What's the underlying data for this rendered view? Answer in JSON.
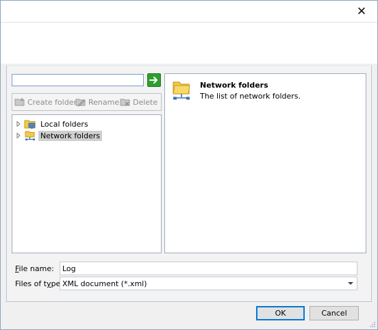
{
  "window": {
    "close_glyph": "✕"
  },
  "search": {
    "value": "",
    "placeholder": ""
  },
  "toolbar": {
    "create_folder_label": "Create folder",
    "rename_label": "Rename",
    "delete_label": "Delete"
  },
  "tree": {
    "items": [
      {
        "label": "Local folders",
        "icon": "local-folders-icon",
        "selected": false
      },
      {
        "label": "Network folders",
        "icon": "network-folders-icon",
        "selected": true
      }
    ]
  },
  "info": {
    "title": "Network folders",
    "description": "The list of network folders.",
    "icon": "network-folders-icon"
  },
  "form": {
    "file_name_label_ul": "F",
    "file_name_label_rest": "ile name:",
    "file_name_value": "Log",
    "file_type_label_pre": "Files of t",
    "file_type_label_ul": "y",
    "file_type_label_post": "pe:",
    "file_type_value": "XML document (*.xml)"
  },
  "buttons": {
    "ok_label": "OK",
    "cancel_label": "Cancel"
  },
  "colors": {
    "go_button": "#2f9e30",
    "selection": "#cfcfcf",
    "default_button_border": "#0078d7"
  }
}
